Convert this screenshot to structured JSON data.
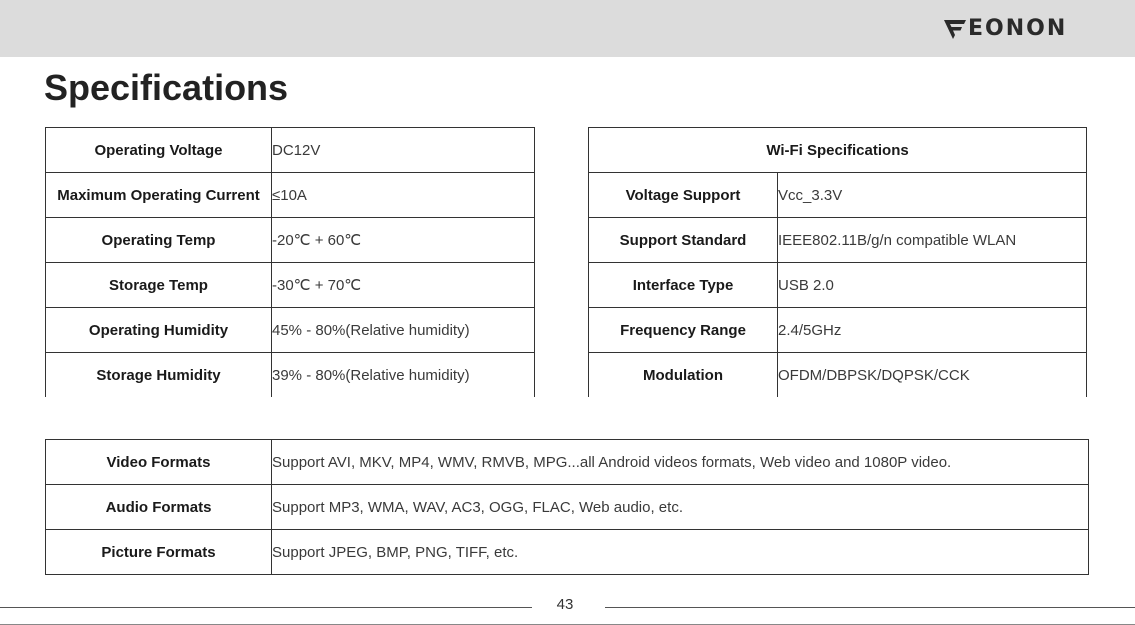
{
  "header": {
    "brand": "EONON"
  },
  "page": {
    "title": "Specifications",
    "number": "43"
  },
  "general_specs": [
    {
      "label": "Operating Voltage",
      "value": "DC12V"
    },
    {
      "label": "Maximum Operating Current",
      "value": "≤10A"
    },
    {
      "label": "Operating Temp",
      "value": "-20℃ + 60℃"
    },
    {
      "label": "Storage Temp",
      "value": "-30℃ + 70℃"
    },
    {
      "label": "Operating Humidity",
      "value": "45% - 80%(Relative humidity)"
    },
    {
      "label": "Storage Humidity",
      "value": "39% - 80%(Relative humidity)"
    }
  ],
  "wifi": {
    "title": "Wi-Fi Specifications",
    "rows": [
      {
        "label": "Voltage Support",
        "value": "Vcc_3.3V"
      },
      {
        "label": "Support Standard",
        "value": "IEEE802.11B/g/n compatible WLAN"
      },
      {
        "label": "Interface Type",
        "value": "USB 2.0"
      },
      {
        "label": "Frequency Range",
        "value": "2.4/5GHz"
      },
      {
        "label": "Modulation",
        "value": "OFDM/DBPSK/DQPSK/CCK"
      }
    ]
  },
  "formats": [
    {
      "label": "Video Formats",
      "value": "Support AVI, MKV, MP4, WMV, RMVB, MPG...all Android videos formats, Web video and 1080P video."
    },
    {
      "label": "Audio Formats",
      "value": "Support MP3, WMA, WAV, AC3, OGG, FLAC, Web audio, etc."
    },
    {
      "label": "Picture Formats",
      "value": "Support JPEG, BMP, PNG, TIFF, etc."
    }
  ]
}
